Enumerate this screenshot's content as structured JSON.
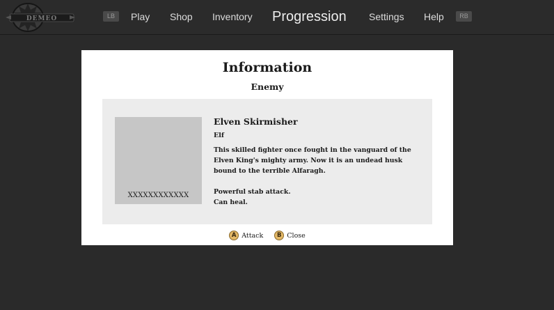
{
  "nav": {
    "left_bumper": "LB",
    "right_bumper": "RB",
    "items": [
      {
        "label": "Play",
        "active": false
      },
      {
        "label": "Shop",
        "active": false
      },
      {
        "label": "Inventory",
        "active": false
      },
      {
        "label": "Progression",
        "active": true
      },
      {
        "label": "Settings",
        "active": false
      },
      {
        "label": "Help",
        "active": false
      }
    ]
  },
  "modal": {
    "title": "Information",
    "subtitle": "Enemy",
    "enemy": {
      "name": "Elven Skirmisher",
      "race": "Elf",
      "description": "This skilled fighter once fought in the vanguard of the Elven King's mighty army. Now it is an undead husk bound to the terrible Alfaragh.",
      "abilities": [
        "Powerful stab attack.",
        "Can heal."
      ],
      "portrait_label": "XXXXXXXXXXXX"
    },
    "actions": [
      {
        "glyph": "A",
        "label": "Attack",
        "icon": "a-button-icon"
      },
      {
        "glyph": "B",
        "label": "Close",
        "icon": "b-button-icon"
      }
    ]
  },
  "colors": {
    "page_background": "#2a2a2a",
    "modal_background": "#ffffff",
    "card_background": "#ececec",
    "portrait_placeholder": "#c6c6c6",
    "button_glyph": "#e3b867"
  }
}
